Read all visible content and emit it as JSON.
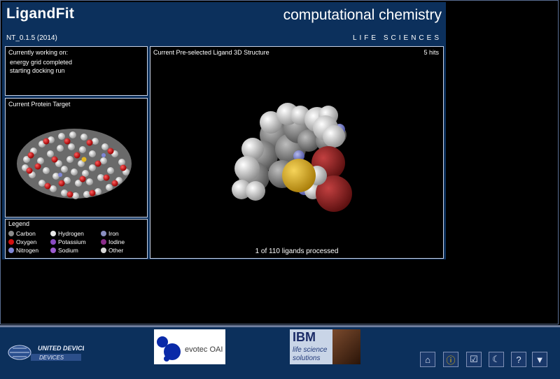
{
  "header": {
    "app_title": "LigandFit",
    "subtitle": "computational chemistry",
    "version": "NT_0.1.5 (2014)",
    "brand": "LIFE SCIENCES"
  },
  "status": {
    "label": "Currently working on:",
    "lines": [
      "energy grid completed",
      "starting docking run"
    ]
  },
  "protein": {
    "label": "Current Protein Target"
  },
  "legend": {
    "label": "Legend",
    "items": [
      {
        "name": "Carbon",
        "color": "#8c8c8c"
      },
      {
        "name": "Hydrogen",
        "color": "#e8e8e8"
      },
      {
        "name": "Iron",
        "color": "#8a8fc0"
      },
      {
        "name": "Oxygen",
        "color": "#d01010"
      },
      {
        "name": "Potassium",
        "color": "#8a4ac2"
      },
      {
        "name": "Iodine",
        "color": "#8a2c8a"
      },
      {
        "name": "Nitrogen",
        "color": "#7f86d6"
      },
      {
        "name": "Sodium",
        "color": "#9c5bcf"
      },
      {
        "name": "Other",
        "color": "#d8d8d8"
      }
    ]
  },
  "ligand": {
    "label": "Current Pre-selected Ligand 3D Structure",
    "count": "5 hits",
    "progress": "1 of 110 ligands processed"
  },
  "footer": {
    "united_devices": "UNITED DEVICES",
    "evotec": "evotec OAI",
    "ibm_brand": "IBM",
    "ibm_line1": "life science",
    "ibm_line2": "solutions"
  },
  "toolbar": {
    "buttons": [
      {
        "name": "home-icon",
        "glyph": "⌂"
      },
      {
        "name": "info-icon",
        "glyph": "ⓘ"
      },
      {
        "name": "checkbox-icon",
        "glyph": "☑"
      },
      {
        "name": "moon-icon",
        "glyph": "☾"
      },
      {
        "name": "help-icon",
        "glyph": "?"
      },
      {
        "name": "minimize-icon",
        "glyph": "▼"
      }
    ]
  }
}
